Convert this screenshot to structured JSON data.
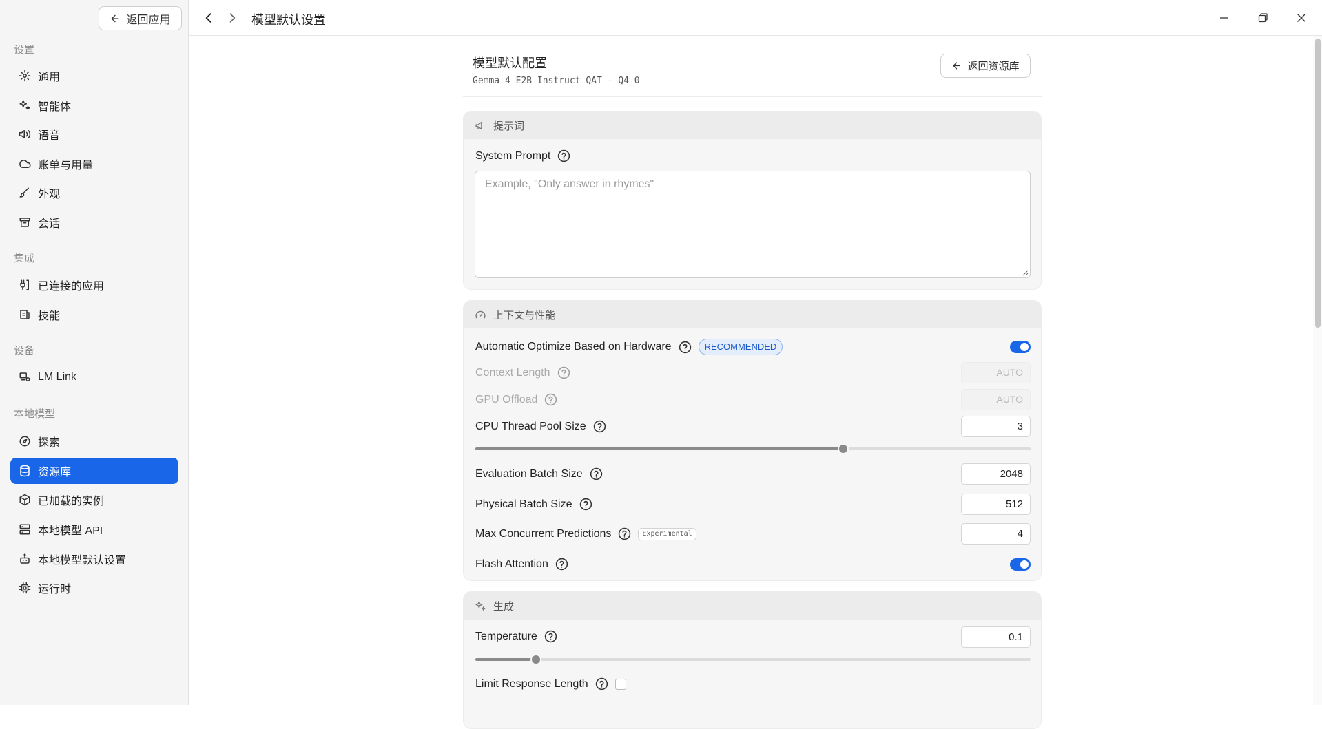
{
  "sidebar": {
    "back_label": "返回应用",
    "sections": {
      "settings": "设置",
      "integrations": "集成",
      "devices": "设备",
      "local_models": "本地模型"
    },
    "items": {
      "general": "通用",
      "agents": "智能体",
      "voice": "语音",
      "billing": "账单与用量",
      "appearance": "外观",
      "sessions": "会话",
      "connected_apps": "已连接的应用",
      "skills": "技能",
      "lm_link": "LM Link",
      "explore": "探索",
      "library": "资源库",
      "loaded_instances": "已加载的实例",
      "local_api": "本地模型 API",
      "local_defaults": "本地模型默认设置",
      "runtime": "运行时"
    },
    "active_item": "library",
    "accent_color": "#1a66e8"
  },
  "titlebar": {
    "title": "模型默认设置"
  },
  "config": {
    "title": "模型默认配置",
    "model_name": "Gemma 4 E2B Instruct QAT - Q4_0",
    "back_label": "返回资源库"
  },
  "prompt_section": {
    "heading": "提示词",
    "system_prompt_label": "System Prompt",
    "system_prompt_value": "",
    "system_prompt_placeholder": "Example, \"Only answer in rhymes\""
  },
  "context_section": {
    "heading": "上下文与性能",
    "auto_optimize_label": "Automatic Optimize Based on Hardware",
    "auto_optimize_badge": "RECOMMENDED",
    "auto_optimize_on": true,
    "context_length_label": "Context Length",
    "context_length_value": "AUTO",
    "gpu_offload_label": "GPU Offload",
    "gpu_offload_value": "AUTO",
    "cpu_threads_label": "CPU Thread Pool Size",
    "cpu_threads_value": "3",
    "cpu_threads_slider_fraction": 0.662,
    "eval_batch_label": "Evaluation Batch Size",
    "eval_batch_value": "2048",
    "physical_batch_label": "Physical Batch Size",
    "physical_batch_value": "512",
    "max_concurrent_label": "Max Concurrent Predictions",
    "max_concurrent_badge": "Experimental",
    "max_concurrent_value": "4",
    "flash_attention_label": "Flash Attention",
    "flash_attention_on": true
  },
  "generation_section": {
    "heading": "生成",
    "temperature_label": "Temperature",
    "temperature_value": "0.1",
    "temperature_slider_fraction": 0.109,
    "limit_length_label": "Limit Response Length",
    "limit_length_checked": false
  }
}
